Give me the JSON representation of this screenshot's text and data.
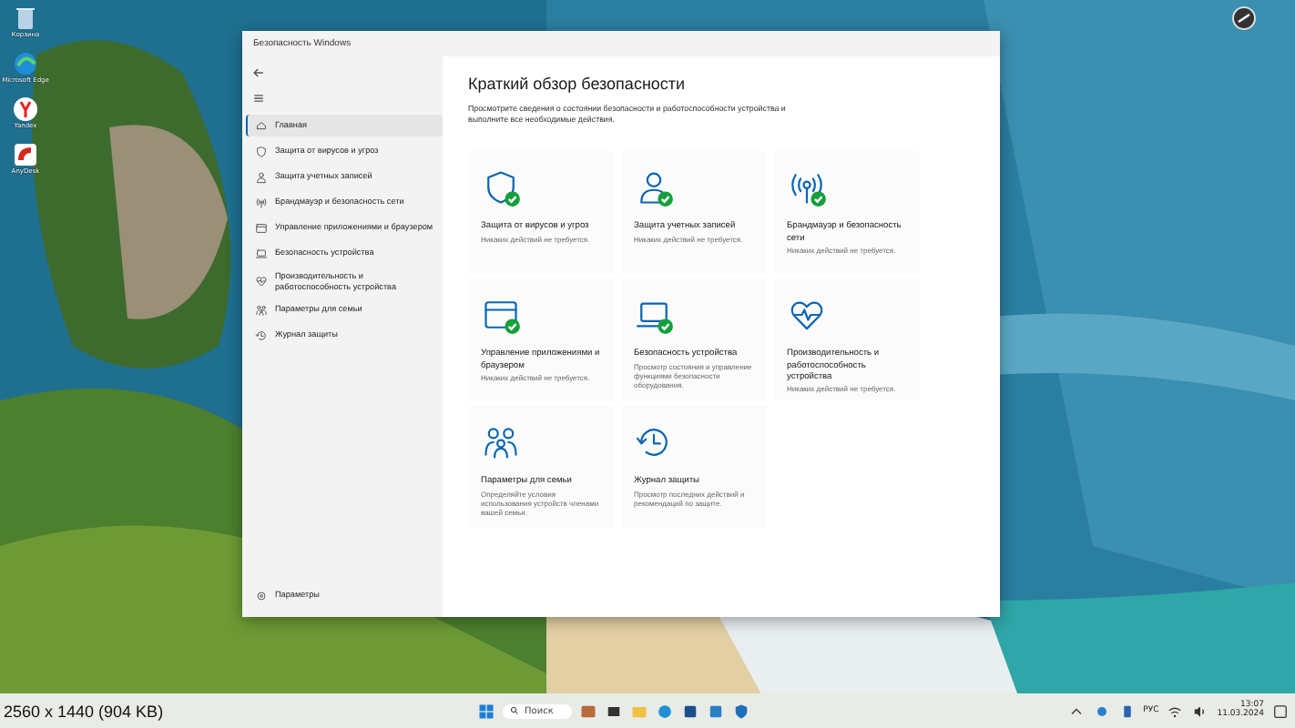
{
  "desktop": {
    "icons": [
      {
        "kind": "bin",
        "label": "Корзина"
      },
      {
        "kind": "edge",
        "label": "Microsoft Edge"
      },
      {
        "kind": "yandex",
        "label": "Yandex"
      },
      {
        "kind": "app",
        "label": "AnyDesk"
      }
    ]
  },
  "window": {
    "title": "Безопасность Windows",
    "nav": [
      {
        "kind": "home",
        "label": "Главная",
        "selected": true
      },
      {
        "kind": "shield",
        "label": "Защита от вирусов и угроз",
        "selected": false
      },
      {
        "kind": "person",
        "label": "Защита учетных записей",
        "selected": false
      },
      {
        "kind": "antenna",
        "label": "Брандмауэр и безопасность сети",
        "selected": false
      },
      {
        "kind": "browser",
        "label": "Управление приложениями и браузером",
        "selected": false
      },
      {
        "kind": "laptop",
        "label": "Безопасность устройства",
        "selected": false
      },
      {
        "kind": "heart",
        "label": "Производительность и работоспособность устройства",
        "selected": false
      },
      {
        "kind": "family",
        "label": "Параметры для семьи",
        "selected": false
      },
      {
        "kind": "history",
        "label": "Журнал защиты",
        "selected": false
      }
    ],
    "settings": "Параметры",
    "heading": "Краткий обзор безопасности",
    "description": "Просмотрите сведения о состоянии безопасности и работоспособности устройства и выполните все необходимые действия.",
    "cards": [
      {
        "kind": "shield",
        "title": "Защита от вирусов и угроз",
        "text": "Никаких действий не требуется.",
        "ok": true
      },
      {
        "kind": "person",
        "title": "Защита учетных записей",
        "text": "Никаких действий не требуется.",
        "ok": true
      },
      {
        "kind": "antenna",
        "title": "Брандмауэр и безопасность сети",
        "text": "Никаких действий не требуется.",
        "ok": true
      },
      {
        "kind": "browser",
        "title": "Управление приложениями и браузером",
        "text": "Никаких действий не требуется.",
        "ok": true
      },
      {
        "kind": "laptop",
        "title": "Безопасность устройства",
        "text": "Просмотр состояния и управление функциями безопасности оборудования.",
        "ok": true
      },
      {
        "kind": "heart",
        "title": "Производительность и работоспособность устройства",
        "text": "Никаких действий не требуется.",
        "ok": false
      },
      {
        "kind": "family",
        "title": "Параметры для семьи",
        "text": "Определяйте условия использования устройств членами вашей семьи.",
        "ok": false
      },
      {
        "kind": "history",
        "title": "Журнал защиты",
        "text": "Просмотр последних действий и рекомендаций по защите.",
        "ok": false
      }
    ]
  },
  "taskbar": {
    "search": "Поиск",
    "language": "РУС",
    "time": "13:07",
    "date": "11.03.2024"
  },
  "caption": "2560 x 1440 (904 KB)"
}
